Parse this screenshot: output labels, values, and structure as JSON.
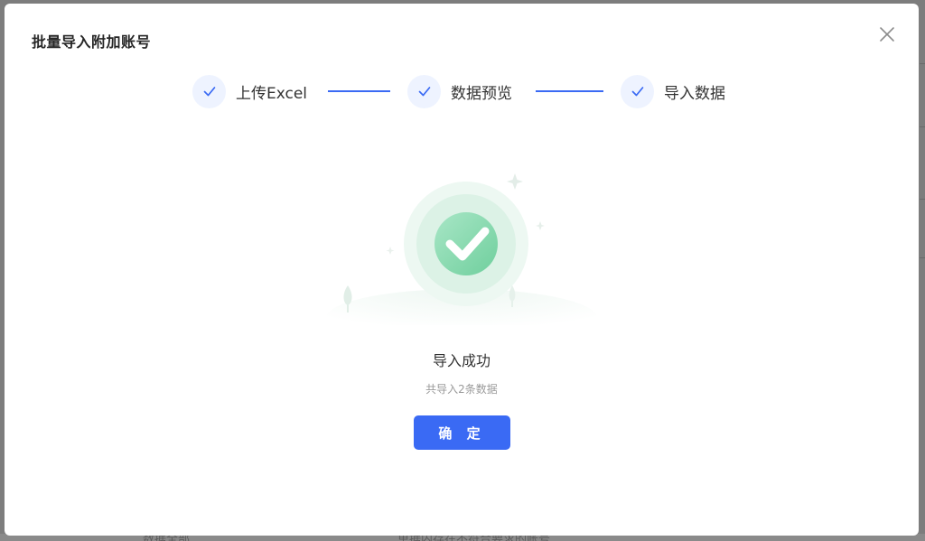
{
  "dialog": {
    "title": "批量导入附加账号",
    "close_icon": "close-icon"
  },
  "steps": [
    {
      "label": "上传Excel",
      "status": "done",
      "icon": "check-icon"
    },
    {
      "label": "数据预览",
      "status": "done",
      "icon": "check-icon"
    },
    {
      "label": "导入数据",
      "status": "done",
      "icon": "check-icon"
    }
  ],
  "result": {
    "icon": "success-check-illustration",
    "title": "导入成功",
    "subtitle": "共导入2条数据"
  },
  "actions": {
    "confirm_label": "确 定"
  },
  "background": {
    "partial_text_left": "数据全部",
    "partial_text_center": "单据内存在不符合要求的账号"
  },
  "colors": {
    "accent": "#3a6af4",
    "success": "#3bbf86",
    "overlay": "#7d7d7d"
  }
}
